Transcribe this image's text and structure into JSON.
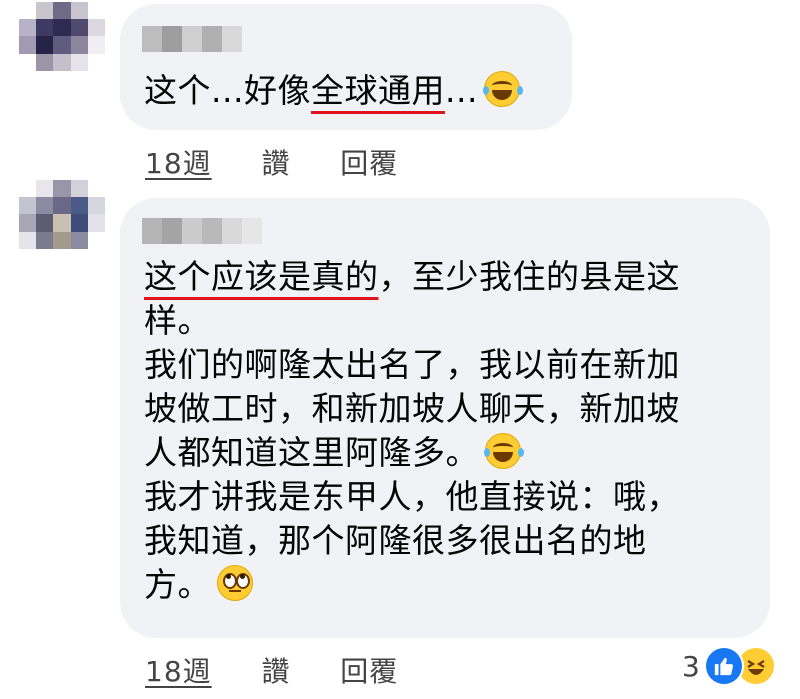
{
  "comments": [
    {
      "segments": [
        {
          "text": "这个...好像",
          "underline": false
        },
        {
          "text": "全球通用",
          "underline": true
        },
        {
          "text": "...",
          "underline": false
        }
      ],
      "emoji": "laughing-tears",
      "time": "18週",
      "like_label": "讚",
      "reply_label": "回覆"
    },
    {
      "lines": [
        {
          "underlined": "这个应该是真的",
          "rest": "，至少我住的县是这"
        },
        {
          "text": "样。"
        },
        {
          "text": "我们的啊隆太出名了，我以前在新加"
        },
        {
          "text": "坡做工时，和新加坡人聊天，新加坡"
        },
        {
          "text": "人都知道这里阿隆多。",
          "emoji": "laughing-tears"
        },
        {
          "text": "我才讲我是东甲人，他直接说：哦，"
        },
        {
          "text": "我知道，那个阿隆很多很出名的地"
        },
        {
          "text": "方。",
          "emoji": "eye-roll"
        }
      ],
      "time": "18週",
      "like_label": "讚",
      "reply_label": "回覆",
      "reaction_count": "3",
      "reaction_icons": [
        "like-icon",
        "haha-icon"
      ]
    }
  ],
  "colors": {
    "bubble": "#f0f2f5",
    "underline": "#e0141e",
    "like": "#1877f2"
  }
}
